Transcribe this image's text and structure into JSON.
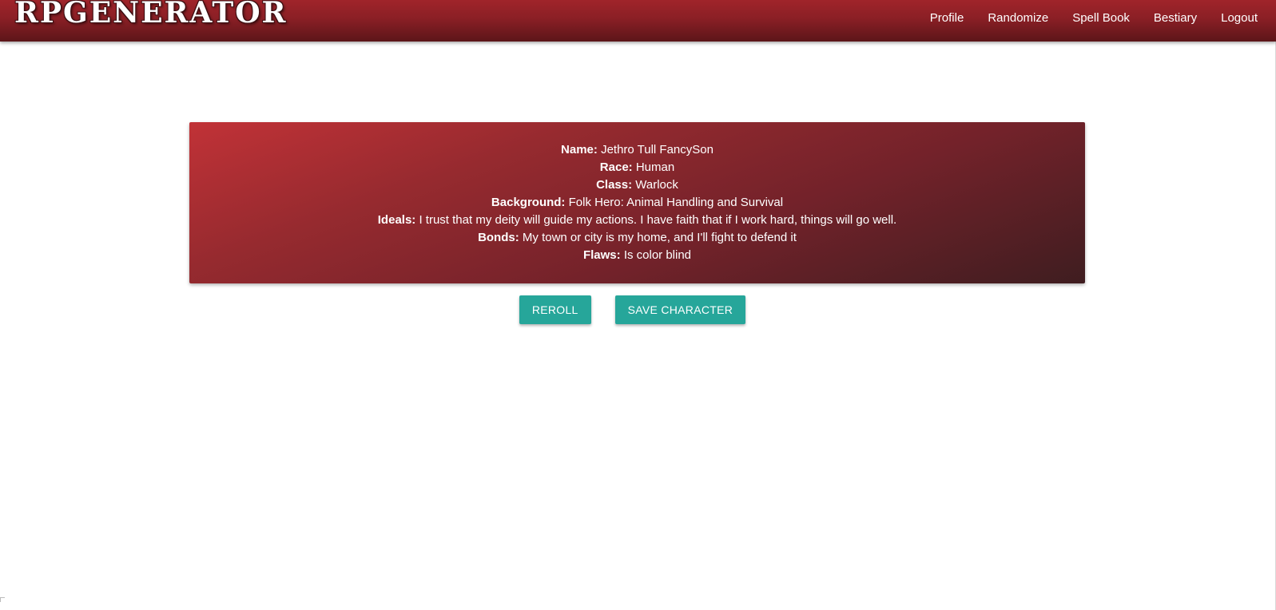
{
  "brand": {
    "logo_text": "RPGENERATOR"
  },
  "nav": {
    "items": [
      {
        "label": "Profile"
      },
      {
        "label": "Randomize"
      },
      {
        "label": "Spell Book"
      },
      {
        "label": "Bestiary"
      },
      {
        "label": "Logout"
      }
    ]
  },
  "character": {
    "name": {
      "label": "Name:",
      "value": "Jethro Tull FancySon"
    },
    "race": {
      "label": "Race:",
      "value": "Human"
    },
    "class": {
      "label": "Class:",
      "value": "Warlock"
    },
    "background": {
      "label": "Background:",
      "value": "Folk Hero: Animal Handling and Survival"
    },
    "ideals": {
      "label": "Ideals:",
      "value": "I trust that my deity will guide my actions. I have faith that if I work hard, things will go well."
    },
    "bonds": {
      "label": "Bonds:",
      "value": "My town or city is my home, and I'll fight to defend it"
    },
    "flaws": {
      "label": "Flaws:",
      "value": "Is color blind"
    }
  },
  "actions": {
    "reroll_label": "Reroll",
    "save_label": "Save Character"
  },
  "colors": {
    "navbar": "#8a1f25",
    "card_start": "#c13237",
    "card_end": "#3f1d20",
    "button": "#26a69a",
    "text_on_dark": "#ffffff"
  }
}
